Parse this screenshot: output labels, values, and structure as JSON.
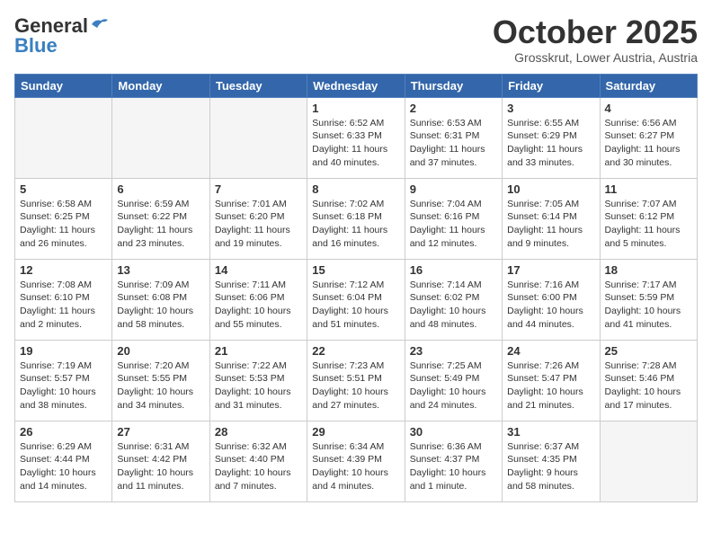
{
  "header": {
    "logo_general": "General",
    "logo_blue": "Blue",
    "month": "October 2025",
    "location": "Grosskrut, Lower Austria, Austria"
  },
  "weekdays": [
    "Sunday",
    "Monday",
    "Tuesday",
    "Wednesday",
    "Thursday",
    "Friday",
    "Saturday"
  ],
  "weeks": [
    [
      {
        "day": "",
        "info": ""
      },
      {
        "day": "",
        "info": ""
      },
      {
        "day": "",
        "info": ""
      },
      {
        "day": "1",
        "info": "Sunrise: 6:52 AM\nSunset: 6:33 PM\nDaylight: 11 hours\nand 40 minutes."
      },
      {
        "day": "2",
        "info": "Sunrise: 6:53 AM\nSunset: 6:31 PM\nDaylight: 11 hours\nand 37 minutes."
      },
      {
        "day": "3",
        "info": "Sunrise: 6:55 AM\nSunset: 6:29 PM\nDaylight: 11 hours\nand 33 minutes."
      },
      {
        "day": "4",
        "info": "Sunrise: 6:56 AM\nSunset: 6:27 PM\nDaylight: 11 hours\nand 30 minutes."
      }
    ],
    [
      {
        "day": "5",
        "info": "Sunrise: 6:58 AM\nSunset: 6:25 PM\nDaylight: 11 hours\nand 26 minutes."
      },
      {
        "day": "6",
        "info": "Sunrise: 6:59 AM\nSunset: 6:22 PM\nDaylight: 11 hours\nand 23 minutes."
      },
      {
        "day": "7",
        "info": "Sunrise: 7:01 AM\nSunset: 6:20 PM\nDaylight: 11 hours\nand 19 minutes."
      },
      {
        "day": "8",
        "info": "Sunrise: 7:02 AM\nSunset: 6:18 PM\nDaylight: 11 hours\nand 16 minutes."
      },
      {
        "day": "9",
        "info": "Sunrise: 7:04 AM\nSunset: 6:16 PM\nDaylight: 11 hours\nand 12 minutes."
      },
      {
        "day": "10",
        "info": "Sunrise: 7:05 AM\nSunset: 6:14 PM\nDaylight: 11 hours\nand 9 minutes."
      },
      {
        "day": "11",
        "info": "Sunrise: 7:07 AM\nSunset: 6:12 PM\nDaylight: 11 hours\nand 5 minutes."
      }
    ],
    [
      {
        "day": "12",
        "info": "Sunrise: 7:08 AM\nSunset: 6:10 PM\nDaylight: 11 hours\nand 2 minutes."
      },
      {
        "day": "13",
        "info": "Sunrise: 7:09 AM\nSunset: 6:08 PM\nDaylight: 10 hours\nand 58 minutes."
      },
      {
        "day": "14",
        "info": "Sunrise: 7:11 AM\nSunset: 6:06 PM\nDaylight: 10 hours\nand 55 minutes."
      },
      {
        "day": "15",
        "info": "Sunrise: 7:12 AM\nSunset: 6:04 PM\nDaylight: 10 hours\nand 51 minutes."
      },
      {
        "day": "16",
        "info": "Sunrise: 7:14 AM\nSunset: 6:02 PM\nDaylight: 10 hours\nand 48 minutes."
      },
      {
        "day": "17",
        "info": "Sunrise: 7:16 AM\nSunset: 6:00 PM\nDaylight: 10 hours\nand 44 minutes."
      },
      {
        "day": "18",
        "info": "Sunrise: 7:17 AM\nSunset: 5:59 PM\nDaylight: 10 hours\nand 41 minutes."
      }
    ],
    [
      {
        "day": "19",
        "info": "Sunrise: 7:19 AM\nSunset: 5:57 PM\nDaylight: 10 hours\nand 38 minutes."
      },
      {
        "day": "20",
        "info": "Sunrise: 7:20 AM\nSunset: 5:55 PM\nDaylight: 10 hours\nand 34 minutes."
      },
      {
        "day": "21",
        "info": "Sunrise: 7:22 AM\nSunset: 5:53 PM\nDaylight: 10 hours\nand 31 minutes."
      },
      {
        "day": "22",
        "info": "Sunrise: 7:23 AM\nSunset: 5:51 PM\nDaylight: 10 hours\nand 27 minutes."
      },
      {
        "day": "23",
        "info": "Sunrise: 7:25 AM\nSunset: 5:49 PM\nDaylight: 10 hours\nand 24 minutes."
      },
      {
        "day": "24",
        "info": "Sunrise: 7:26 AM\nSunset: 5:47 PM\nDaylight: 10 hours\nand 21 minutes."
      },
      {
        "day": "25",
        "info": "Sunrise: 7:28 AM\nSunset: 5:46 PM\nDaylight: 10 hours\nand 17 minutes."
      }
    ],
    [
      {
        "day": "26",
        "info": "Sunrise: 6:29 AM\nSunset: 4:44 PM\nDaylight: 10 hours\nand 14 minutes."
      },
      {
        "day": "27",
        "info": "Sunrise: 6:31 AM\nSunset: 4:42 PM\nDaylight: 10 hours\nand 11 minutes."
      },
      {
        "day": "28",
        "info": "Sunrise: 6:32 AM\nSunset: 4:40 PM\nDaylight: 10 hours\nand 7 minutes."
      },
      {
        "day": "29",
        "info": "Sunrise: 6:34 AM\nSunset: 4:39 PM\nDaylight: 10 hours\nand 4 minutes."
      },
      {
        "day": "30",
        "info": "Sunrise: 6:36 AM\nSunset: 4:37 PM\nDaylight: 10 hours\nand 1 minute."
      },
      {
        "day": "31",
        "info": "Sunrise: 6:37 AM\nSunset: 4:35 PM\nDaylight: 9 hours\nand 58 minutes."
      },
      {
        "day": "",
        "info": ""
      }
    ]
  ]
}
